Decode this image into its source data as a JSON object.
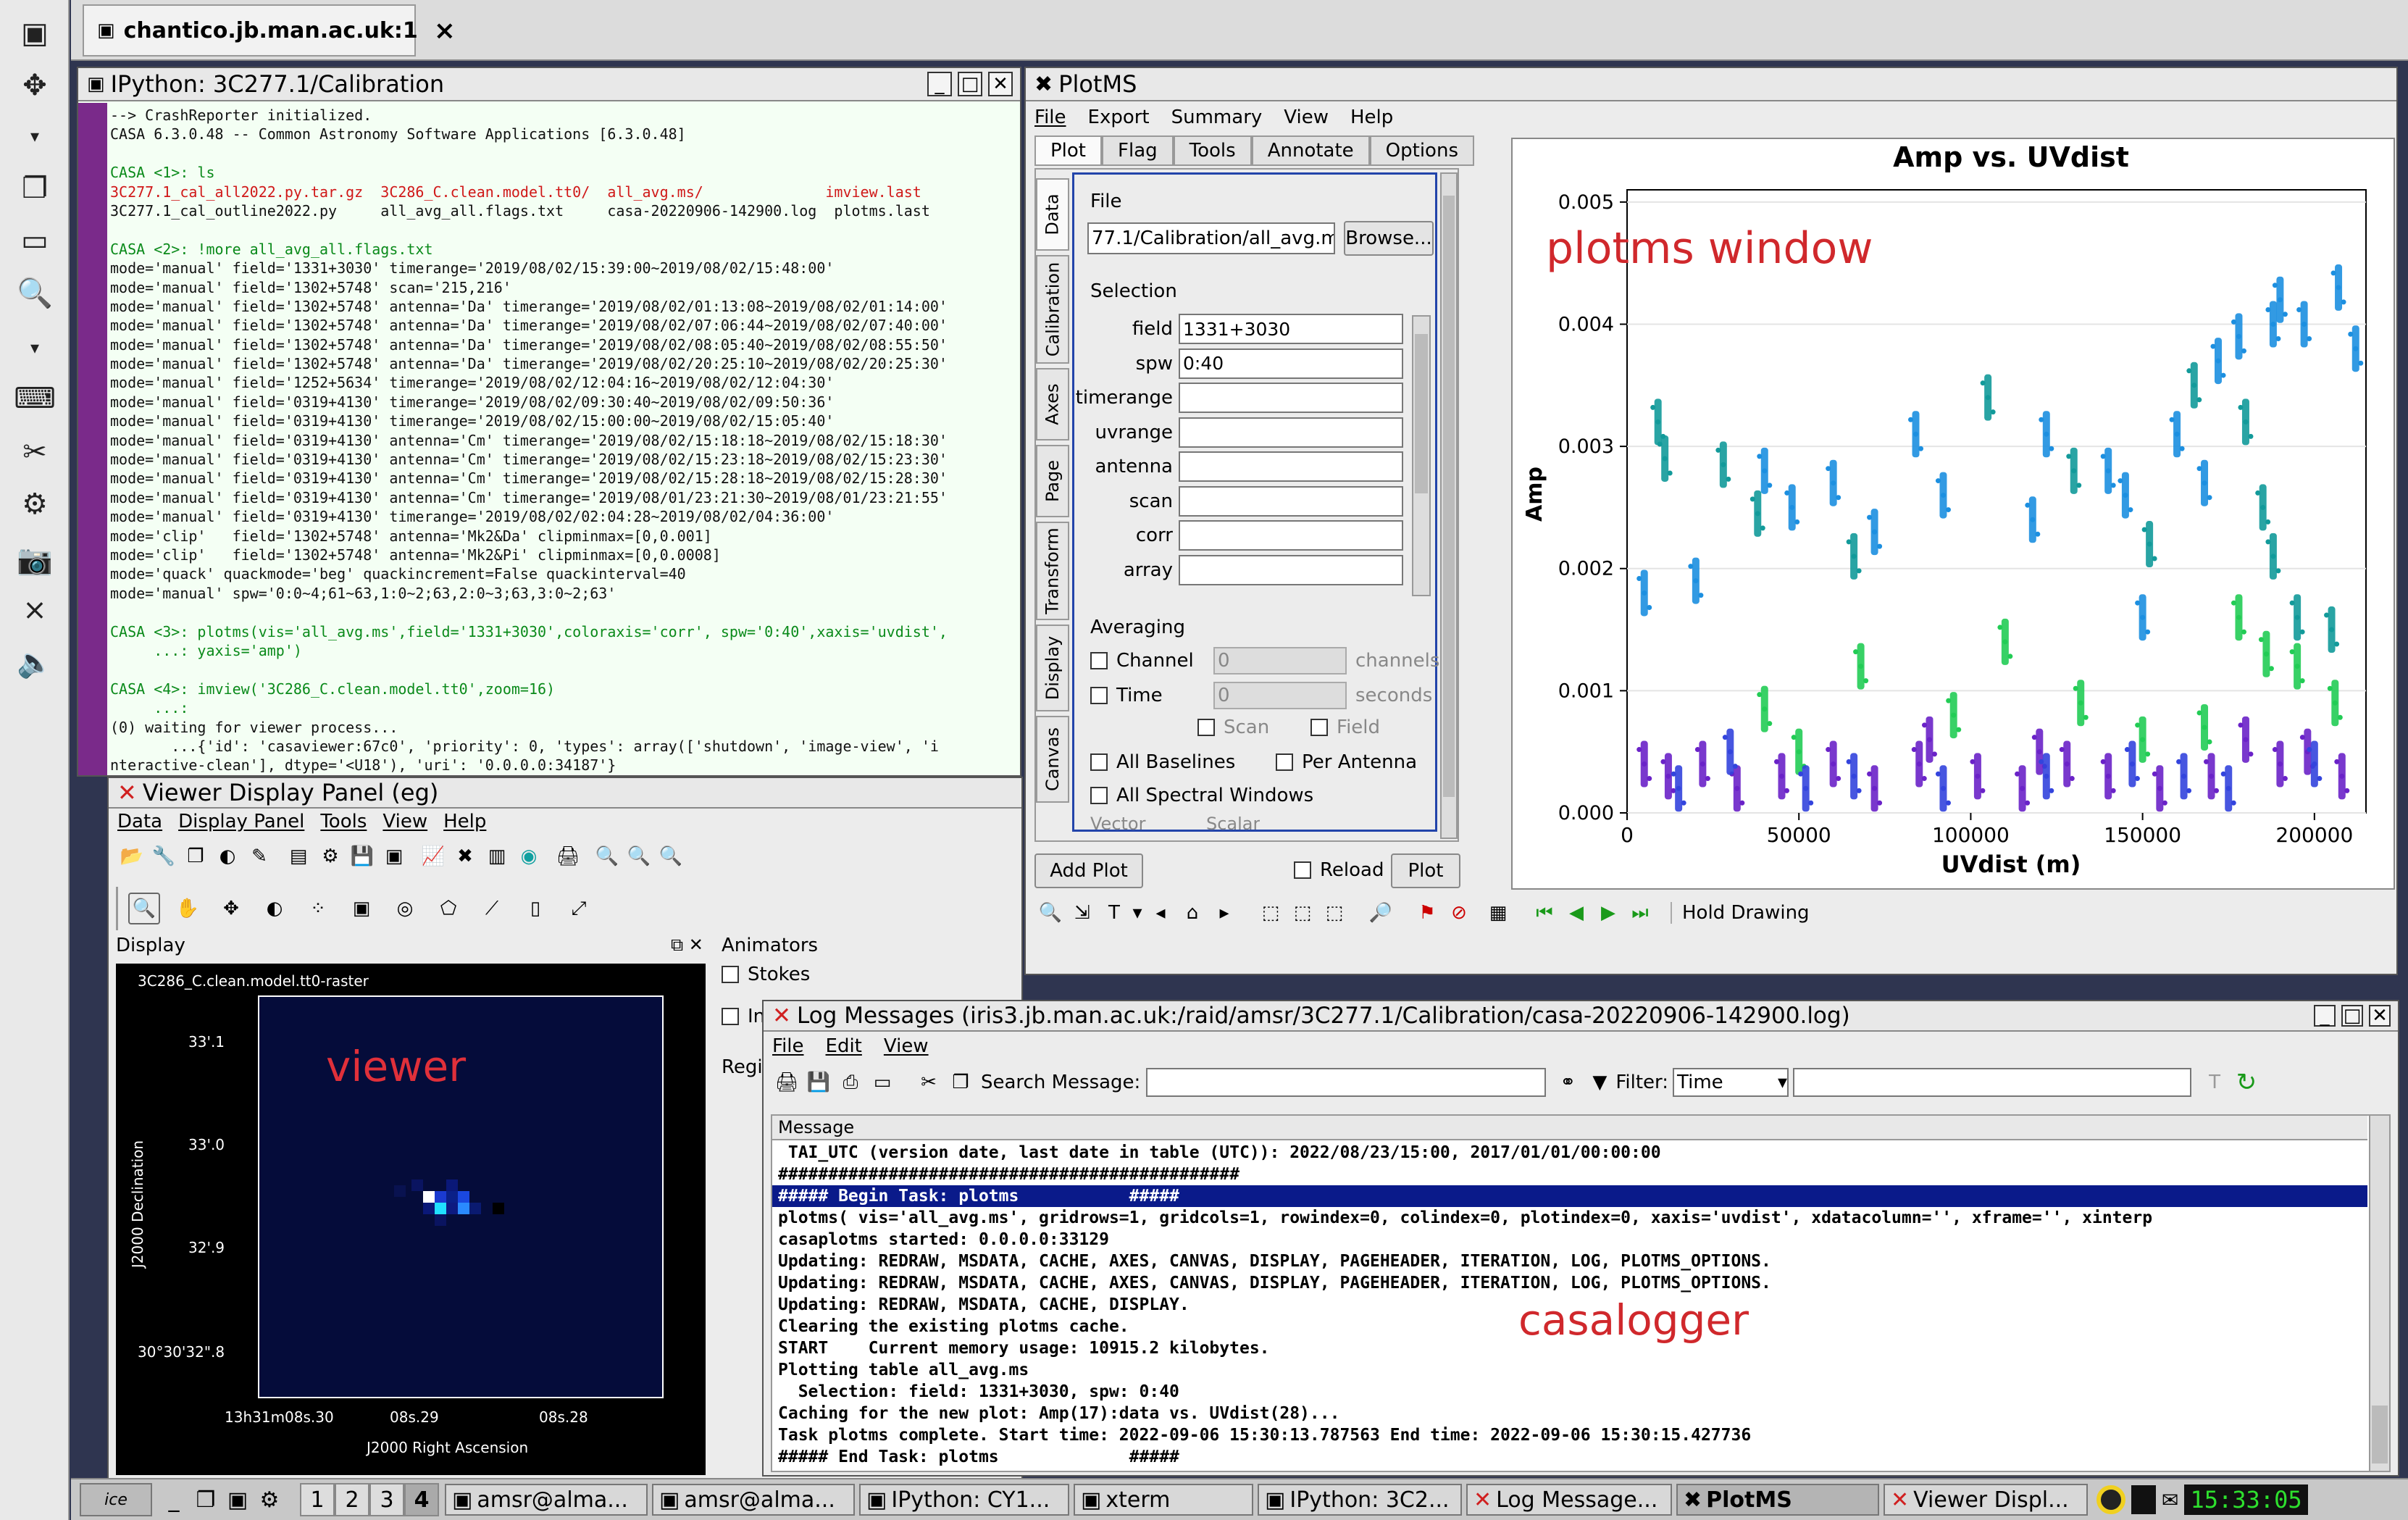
{
  "desktop": {
    "top_tab": "chantico.jb.man.ac.uk:1",
    "top_tab_close": "×"
  },
  "ipython": {
    "title": "IPython: 3C277.1/Calibration",
    "lines": [
      {
        "t": "--> CrashReporter initialized.",
        "c": "#111"
      },
      {
        "t": "CASA 6.3.0.48 -- Common Astronomy Software Applications [6.3.0.48]",
        "c": "#111"
      },
      {
        "t": "",
        "c": "#111"
      },
      {
        "t": "CASA <1>: ls",
        "c": "#0a8a1a"
      },
      {
        "t": "3C277.1_cal_all2022.py.tar.gz  3C286_C.clean.model.tt0/  all_avg.ms/              imview.last",
        "c": "#d01818"
      },
      {
        "t": "3C277.1_cal_outline2022.py     all_avg_all.flags.txt     casa-20220906-142900.log  plotms.last",
        "c": "#111"
      },
      {
        "t": "",
        "c": "#111"
      },
      {
        "t": "CASA <2>: !more all_avg_all.flags.txt",
        "c": "#0a8a1a"
      },
      {
        "t": "mode='manual' field='1331+3030' timerange='2019/08/02/15:39:00~2019/08/02/15:48:00'",
        "c": "#111"
      },
      {
        "t": "mode='manual' field='1302+5748' scan='215,216'",
        "c": "#111"
      },
      {
        "t": "mode='manual' field='1302+5748' antenna='Da' timerange='2019/08/02/01:13:08~2019/08/02/01:14:00'",
        "c": "#111"
      },
      {
        "t": "mode='manual' field='1302+5748' antenna='Da' timerange='2019/08/02/07:06:44~2019/08/02/07:40:00'",
        "c": "#111"
      },
      {
        "t": "mode='manual' field='1302+5748' antenna='Da' timerange='2019/08/02/08:05:40~2019/08/02/08:55:50'",
        "c": "#111"
      },
      {
        "t": "mode='manual' field='1302+5748' antenna='Da' timerange='2019/08/02/20:25:10~2019/08/02/20:25:30'",
        "c": "#111"
      },
      {
        "t": "mode='manual' field='1252+5634' timerange='2019/08/02/12:04:16~2019/08/02/12:04:30'",
        "c": "#111"
      },
      {
        "t": "mode='manual' field='0319+4130' timerange='2019/08/02/09:30:40~2019/08/02/09:50:36'",
        "c": "#111"
      },
      {
        "t": "mode='manual' field='0319+4130' timerange='2019/08/02/15:00:00~2019/08/02/15:05:40'",
        "c": "#111"
      },
      {
        "t": "mode='manual' field='0319+4130' antenna='Cm' timerange='2019/08/02/15:18:18~2019/08/02/15:18:30'",
        "c": "#111"
      },
      {
        "t": "mode='manual' field='0319+4130' antenna='Cm' timerange='2019/08/02/15:23:18~2019/08/02/15:23:30'",
        "c": "#111"
      },
      {
        "t": "mode='manual' field='0319+4130' antenna='Cm' timerange='2019/08/02/15:28:18~2019/08/02/15:28:30'",
        "c": "#111"
      },
      {
        "t": "mode='manual' field='0319+4130' antenna='Cm' timerange='2019/08/01/23:21:30~2019/08/01/23:21:55'",
        "c": "#111"
      },
      {
        "t": "mode='manual' field='0319+4130' timerange='2019/08/02/02:04:28~2019/08/02/04:36:00'",
        "c": "#111"
      },
      {
        "t": "mode='clip'   field='1302+5748' antenna='Mk2&Da' clipminmax=[0,0.001]",
        "c": "#111"
      },
      {
        "t": "mode='clip'   field='1302+5748' antenna='Mk2&Pi' clipminmax=[0,0.0008]",
        "c": "#111"
      },
      {
        "t": "mode='quack' quackmode='beg' quackincrement=False quackinterval=40",
        "c": "#111"
      },
      {
        "t": "mode='manual' spw='0:0~4;61~63,1:0~2;63,2:0~3;63,3:0~2;63'",
        "c": "#111"
      },
      {
        "t": "",
        "c": "#111"
      },
      {
        "t": "CASA <3>: plotms(vis='all_avg.ms',field='1331+3030',coloraxis='corr', spw='0:40',xaxis='uvdist',",
        "c": "#0a8a1a"
      },
      {
        "t": "     ...: yaxis='amp')",
        "c": "#0a8a1a"
      },
      {
        "t": "",
        "c": "#111"
      },
      {
        "t": "CASA <4>: imview('3C286_C.clean.model.tt0',zoom=16)",
        "c": "#0a8a1a"
      },
      {
        "t": "     ...:",
        "c": "#0a8a1a"
      },
      {
        "t": "(0) waiting for viewer process...",
        "c": "#111"
      },
      {
        "t": "       ...{'id': 'casaviewer:67c0', 'priority': 0, 'types': array(['shutdown', 'image-view', 'i",
        "c": "#111"
      },
      {
        "t": "nteractive-clean'], dtype='<U18'), 'uri': '0.0.0.0:34187'}",
        "c": "#111"
      }
    ]
  },
  "plotms": {
    "title": "PlotMS",
    "menu": [
      "File",
      "Export",
      "Summary",
      "View",
      "Help"
    ],
    "tabs": [
      "Plot",
      "Flag",
      "Tools",
      "Annotate",
      "Options"
    ],
    "side_tabs": [
      "Data",
      "Calibration",
      "Axes",
      "Page",
      "Transform",
      "Display",
      "Canvas"
    ],
    "file_label": "File",
    "file_value": "77.1/Calibration/all_avg.ms",
    "browse": "Browse...",
    "selection_label": "Selection",
    "sel_fields": [
      {
        "label": "field",
        "value": "1331+3030"
      },
      {
        "label": "spw",
        "value": "0:40"
      },
      {
        "label": "timerange",
        "value": ""
      },
      {
        "label": "uvrange",
        "value": ""
      },
      {
        "label": "antenna",
        "value": ""
      },
      {
        "label": "scan",
        "value": ""
      },
      {
        "label": "corr",
        "value": ""
      },
      {
        "label": "array",
        "value": ""
      }
    ],
    "averaging_label": "Averaging",
    "avg_channel": "Channel",
    "avg_channel_val": "0",
    "avg_channel_unit": "channels",
    "avg_time": "Time",
    "avg_time_val": "0",
    "avg_time_unit": "seconds",
    "scan": "Scan",
    "field": "Field",
    "all_baselines": "All Baselines",
    "per_antenna": "Per Antenna",
    "all_spw": "All Spectral Windows",
    "vector": "Vector",
    "scalar": "Scalar",
    "add_plot": "Add Plot",
    "reload": "Reload",
    "plot": "Plot",
    "hold_drawing": "Hold Drawing",
    "annotation": "plotms window"
  },
  "chart_data": {
    "type": "scatter",
    "title": "Amp vs. UVdist",
    "xlabel": "UVdist (m)",
    "ylabel": "Amp",
    "xlim": [
      0,
      215000
    ],
    "ylim": [
      0,
      0.0051
    ],
    "x_ticks": [
      "0",
      "50000",
      "100000",
      "150000",
      "200000"
    ],
    "y_ticks": [
      "0.000",
      "0.001",
      "0.002",
      "0.003",
      "0.004",
      "0.005"
    ],
    "x_tick_values": [
      0,
      50000,
      100000,
      150000,
      200000
    ],
    "y_tick_values": [
      0,
      0.001,
      0.002,
      0.003,
      0.004,
      0.005
    ],
    "colors": [
      "#1c8fe0",
      "#129a9a",
      "#22cc55",
      "#6a22c8",
      "#3344dd"
    ],
    "series": [
      {
        "color": "#129a9a",
        "points": [
          [
            9000,
            0.0032
          ],
          [
            11000,
            0.0029
          ],
          [
            28000,
            0.00285
          ],
          [
            38000,
            0.00245
          ],
          [
            66000,
            0.0021
          ],
          [
            105000,
            0.0034
          ],
          [
            130000,
            0.0028
          ],
          [
            152000,
            0.0022
          ],
          [
            165000,
            0.0035
          ],
          [
            180000,
            0.0032
          ],
          [
            185000,
            0.0025
          ],
          [
            188000,
            0.0021
          ],
          [
            195000,
            0.0016
          ],
          [
            205000,
            0.0015
          ]
        ]
      },
      {
        "color": "#1c8fe0",
        "points": [
          [
            5000,
            0.0018
          ],
          [
            20000,
            0.0019
          ],
          [
            40000,
            0.0028
          ],
          [
            48000,
            0.0025
          ],
          [
            60000,
            0.0027
          ],
          [
            72000,
            0.0023
          ],
          [
            84000,
            0.0031
          ],
          [
            92000,
            0.0026
          ],
          [
            118000,
            0.0024
          ],
          [
            122000,
            0.0031
          ],
          [
            140000,
            0.0028
          ],
          [
            145000,
            0.0026
          ],
          [
            160000,
            0.0031
          ],
          [
            172000,
            0.0037
          ],
          [
            178000,
            0.0039
          ],
          [
            188000,
            0.004
          ],
          [
            190000,
            0.0042
          ],
          [
            197000,
            0.004
          ],
          [
            207000,
            0.0043
          ],
          [
            212000,
            0.0038
          ],
          [
            150000,
            0.0016
          ],
          [
            168000,
            0.0027
          ]
        ]
      },
      {
        "color": "#22cc55",
        "points": [
          [
            40000,
            0.00085
          ],
          [
            50000,
            0.0005
          ],
          [
            68000,
            0.0012
          ],
          [
            95000,
            0.0008
          ],
          [
            110000,
            0.0014
          ],
          [
            132000,
            0.0009
          ],
          [
            150000,
            0.0006
          ],
          [
            168000,
            0.0007
          ],
          [
            178000,
            0.0016
          ],
          [
            186000,
            0.0013
          ],
          [
            195000,
            0.0012
          ],
          [
            206000,
            0.0009
          ]
        ]
      },
      {
        "color": "#6a22c8",
        "points": [
          [
            5000,
            0.0004
          ],
          [
            12000,
            0.0003
          ],
          [
            22000,
            0.0004
          ],
          [
            32000,
            0.0002
          ],
          [
            45000,
            0.0003
          ],
          [
            60000,
            0.0004
          ],
          [
            72000,
            0.0002
          ],
          [
            85000,
            0.0004
          ],
          [
            102000,
            0.0003
          ],
          [
            115000,
            0.0002
          ],
          [
            128000,
            0.0004
          ],
          [
            140000,
            0.0003
          ],
          [
            155000,
            0.0002
          ],
          [
            170000,
            0.0003
          ],
          [
            180000,
            0.0006
          ],
          [
            190000,
            0.0004
          ],
          [
            198000,
            0.0005
          ],
          [
            208000,
            0.0003
          ],
          [
            88000,
            0.0006
          ],
          [
            120000,
            0.0005
          ]
        ]
      },
      {
        "color": "#3344dd",
        "points": [
          [
            15000,
            0.0002
          ],
          [
            30000,
            0.0005
          ],
          [
            52000,
            0.0002
          ],
          [
            66000,
            0.0003
          ],
          [
            92000,
            0.0002
          ],
          [
            122000,
            0.0003
          ],
          [
            147000,
            0.0004
          ],
          [
            162000,
            0.0003
          ],
          [
            175000,
            0.0002
          ],
          [
            200000,
            0.0004
          ]
        ]
      }
    ]
  },
  "viewer": {
    "title": "Viewer Display Panel (eg)",
    "menu": [
      "Data",
      "Display Panel",
      "Tools",
      "View",
      "Help"
    ],
    "display_label": "Display",
    "animators_label": "Animators",
    "stokes": "Stokes",
    "in_label": "In",
    "regi_label": "Regi",
    "raster_label": "3C286_C.clean.model.tt0-raster",
    "y_ticks": [
      "33'.1",
      "33'.0",
      "32'.9",
      "30°30'32\".8"
    ],
    "x_ticks": [
      "13h31m08s.30",
      "08s.29",
      "08s.28"
    ],
    "ylabel": "J2000 Declination",
    "xlabel": "J2000 Right Ascension",
    "annotation": "viewer"
  },
  "logger": {
    "title": "Log Messages (iris3.jb.man.ac.uk:/raid/amsr/3C277.1/Calibration/casa-20220906-142900.log)",
    "menu": [
      "File",
      "Edit",
      "View"
    ],
    "search_label": "Search Message:",
    "filter_label": "Filter:",
    "filter_value": "Time",
    "column": "Message",
    "annotation": "casalogger",
    "lines": [
      " TAI_UTC (version date, last date in table (UTC)): 2022/08/23/15:00, 2017/01/01/00:00:00",
      "##############################################",
      "##### Begin Task: plotms           #####",
      "plotms( vis='all_avg.ms', gridrows=1, gridcols=1, rowindex=0, colindex=0, plotindex=0, xaxis='uvdist', xdatacolumn='', xframe='', xinterp",
      "casaplotms started: 0.0.0.0:33129",
      "Updating: REDRAW, MSDATA, CACHE, AXES, CANVAS, DISPLAY, PAGEHEADER, ITERATION, LOG, PLOTMS_OPTIONS.",
      "Updating: REDRAW, MSDATA, CACHE, AXES, CANVAS, DISPLAY, PAGEHEADER, ITERATION, LOG, PLOTMS_OPTIONS.",
      "Updating: REDRAW, MSDATA, CACHE, DISPLAY.",
      "Clearing the existing plotms cache.",
      "START    Current memory usage: 10915.2 kilobytes.",
      "Plotting table all_avg.ms",
      "  Selection: field: 1331+3030, spw: 0:40",
      "Caching for the new plot: Amp(17):data vs. UVdist(28)...",
      "Task plotms complete. Start time: 2022-09-06 15:30:13.787563 End time: 2022-09-06 15:30:15.427736",
      "##### End Task: plotms             #####"
    ]
  },
  "taskbar": {
    "workspaces": [
      "1",
      "2",
      "3",
      "4"
    ],
    "items": [
      "amsr@alma...",
      "amsr@alma...",
      "IPython: CY1...",
      "xterm",
      "IPython: 3C2...",
      "Log Message...",
      "PlotMS",
      "Viewer Displ..."
    ],
    "clock": "15:33:05"
  }
}
